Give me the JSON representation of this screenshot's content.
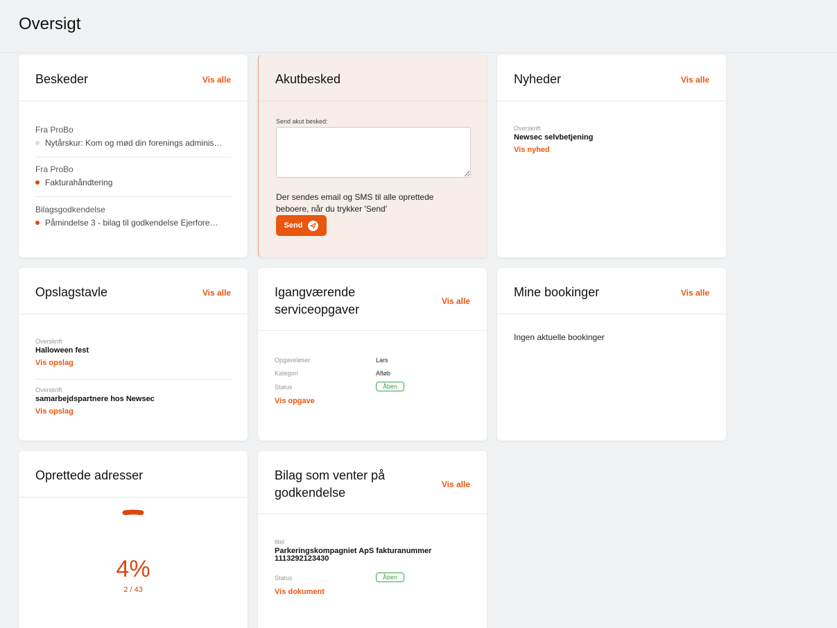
{
  "page": {
    "title": "Oversigt"
  },
  "beskeder": {
    "title": "Beskeder",
    "vis_alle": "Vis alle",
    "items": [
      {
        "from": "Fra ProBo",
        "subject": "Nytårskur: Kom og mød din forenings adminis…",
        "read": true
      },
      {
        "from": "Fra ProBo",
        "subject": "Fakturahåndtering",
        "read": false
      },
      {
        "from": "Bilagsgodkendelse",
        "subject": "Påmindelse 3 - bilag til godkendelse Ejerfore…",
        "read": false
      }
    ]
  },
  "akutbesked": {
    "title": "Akutbesked",
    "field_label": "Send akut besked:",
    "value": "",
    "info_line1": "Der sendes email og SMS til alle oprettede",
    "info_line2": "beboere, når du trykker 'Send'",
    "send_label": "Send"
  },
  "nyheder": {
    "title": "Nyheder",
    "vis_alle": "Vis alle",
    "item": {
      "label": "Overskrift",
      "title": "Newsec selvbetjening",
      "link": "Vis nyhed"
    }
  },
  "opslagstavle": {
    "title": "Opslagstavle",
    "vis_alle": "Vis alle",
    "items": [
      {
        "label": "Overskrift",
        "title": "Halloween fest",
        "link": "Vis opslag"
      },
      {
        "label": "Overskrift",
        "title": "samarbejdspartnere hos Newsec",
        "link": "Vis opslag"
      }
    ]
  },
  "serviceopgaver": {
    "title_line1": "Igangværende",
    "title_line2": "serviceopgaver",
    "vis_alle": "Vis alle",
    "rows": [
      {
        "key": "Opgaveløser",
        "value": "Lars"
      },
      {
        "key": "Kategori",
        "value": "Afløb"
      }
    ],
    "status_key": "Status",
    "status_value": "Åben",
    "link": "Vis opgave"
  },
  "bookinger": {
    "title": "Mine bookinger",
    "vis_alle": "Vis alle",
    "empty": "Ingen aktuelle bookinger"
  },
  "adresser": {
    "title": "Oprettede adresser",
    "percent_text": "4%",
    "fraction_text": "2 / 43",
    "progress": 0.04651
  },
  "bilag": {
    "title_line1": "Bilag som venter på",
    "title_line2": "godkendelse",
    "vis_alle": "Vis alle",
    "titel_label": "titel",
    "titel_line1": "Parkeringskompagniet ApS fakturanummer",
    "titel_line2": "1113292123430",
    "status_key": "Status",
    "status_value": "Åben",
    "link": "Vis dokument"
  },
  "colors": {
    "accent": "#e8560f",
    "status_green": "#3ca44a",
    "akut_bg": "#f7ede9",
    "page_bg": "#f0f2f3"
  }
}
